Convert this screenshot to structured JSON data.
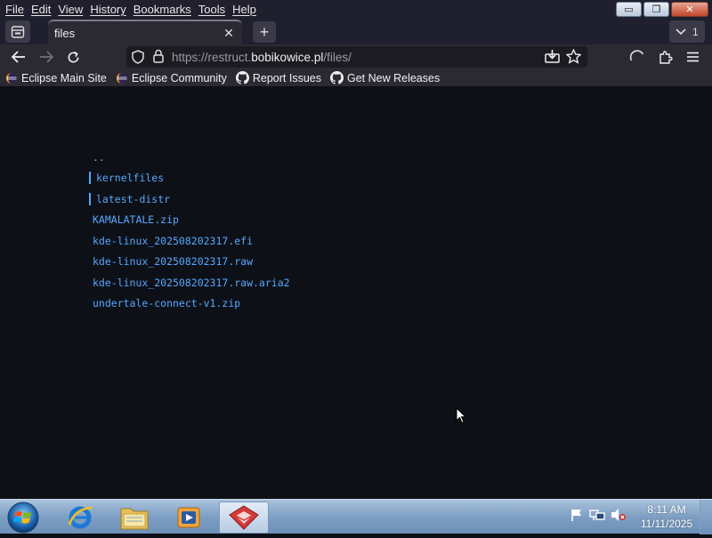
{
  "menubar": {
    "items": [
      {
        "label": "File",
        "name": "menu-file"
      },
      {
        "label": "Edit",
        "name": "menu-edit"
      },
      {
        "label": "View",
        "name": "menu-view"
      },
      {
        "label": "History",
        "name": "menu-history"
      },
      {
        "label": "Bookmarks",
        "name": "menu-bookmarks"
      },
      {
        "label": "Tools",
        "name": "menu-tools"
      },
      {
        "label": "Help",
        "name": "menu-help"
      }
    ],
    "window_controls": {
      "minimize": "▭",
      "restore": "❐",
      "close": "✕"
    }
  },
  "tabs": {
    "active_title": "files",
    "close_glyph": "✕",
    "new_tab_glyph": "+",
    "overflow_count": "1"
  },
  "navbar": {
    "url_prefix": "https://restruct.",
    "url_host": "bobikowice.pl",
    "url_path": "/files/"
  },
  "bookmarks": [
    {
      "label": "Eclipse Main Site",
      "icon": "eclipse-icon"
    },
    {
      "label": "Eclipse Community",
      "icon": "eclipse-icon"
    },
    {
      "label": "Report Issues",
      "icon": "github-icon"
    },
    {
      "label": "Get New Releases",
      "icon": "github-icon"
    }
  ],
  "listing": {
    "entries": [
      {
        "name": "..",
        "type": "parent"
      },
      {
        "name": "kernelfiles",
        "type": "dir"
      },
      {
        "name": "latest-distr",
        "type": "dir"
      },
      {
        "name": "KAMALATALE.zip",
        "type": "file"
      },
      {
        "name": "kde-linux_202508202317.efi",
        "type": "file"
      },
      {
        "name": "kde-linux_202508202317.raw",
        "type": "file"
      },
      {
        "name": "kde-linux_202508202317.raw.aria2",
        "type": "file"
      },
      {
        "name": "undertale-connect-v1.zip",
        "type": "file"
      }
    ],
    "link_color": "#58a6ff"
  },
  "taskbar": {
    "time": "8:11 AM",
    "date": "11/11/2025",
    "items": [
      "internet-explorer-icon",
      "file-explorer-icon",
      "media-player-icon",
      "gns3-app-icon"
    ]
  },
  "colors": {
    "page_bg": "#0d1117",
    "chrome_bg": "#2b2a33",
    "titlebar_bg": "#1f1f2e"
  }
}
